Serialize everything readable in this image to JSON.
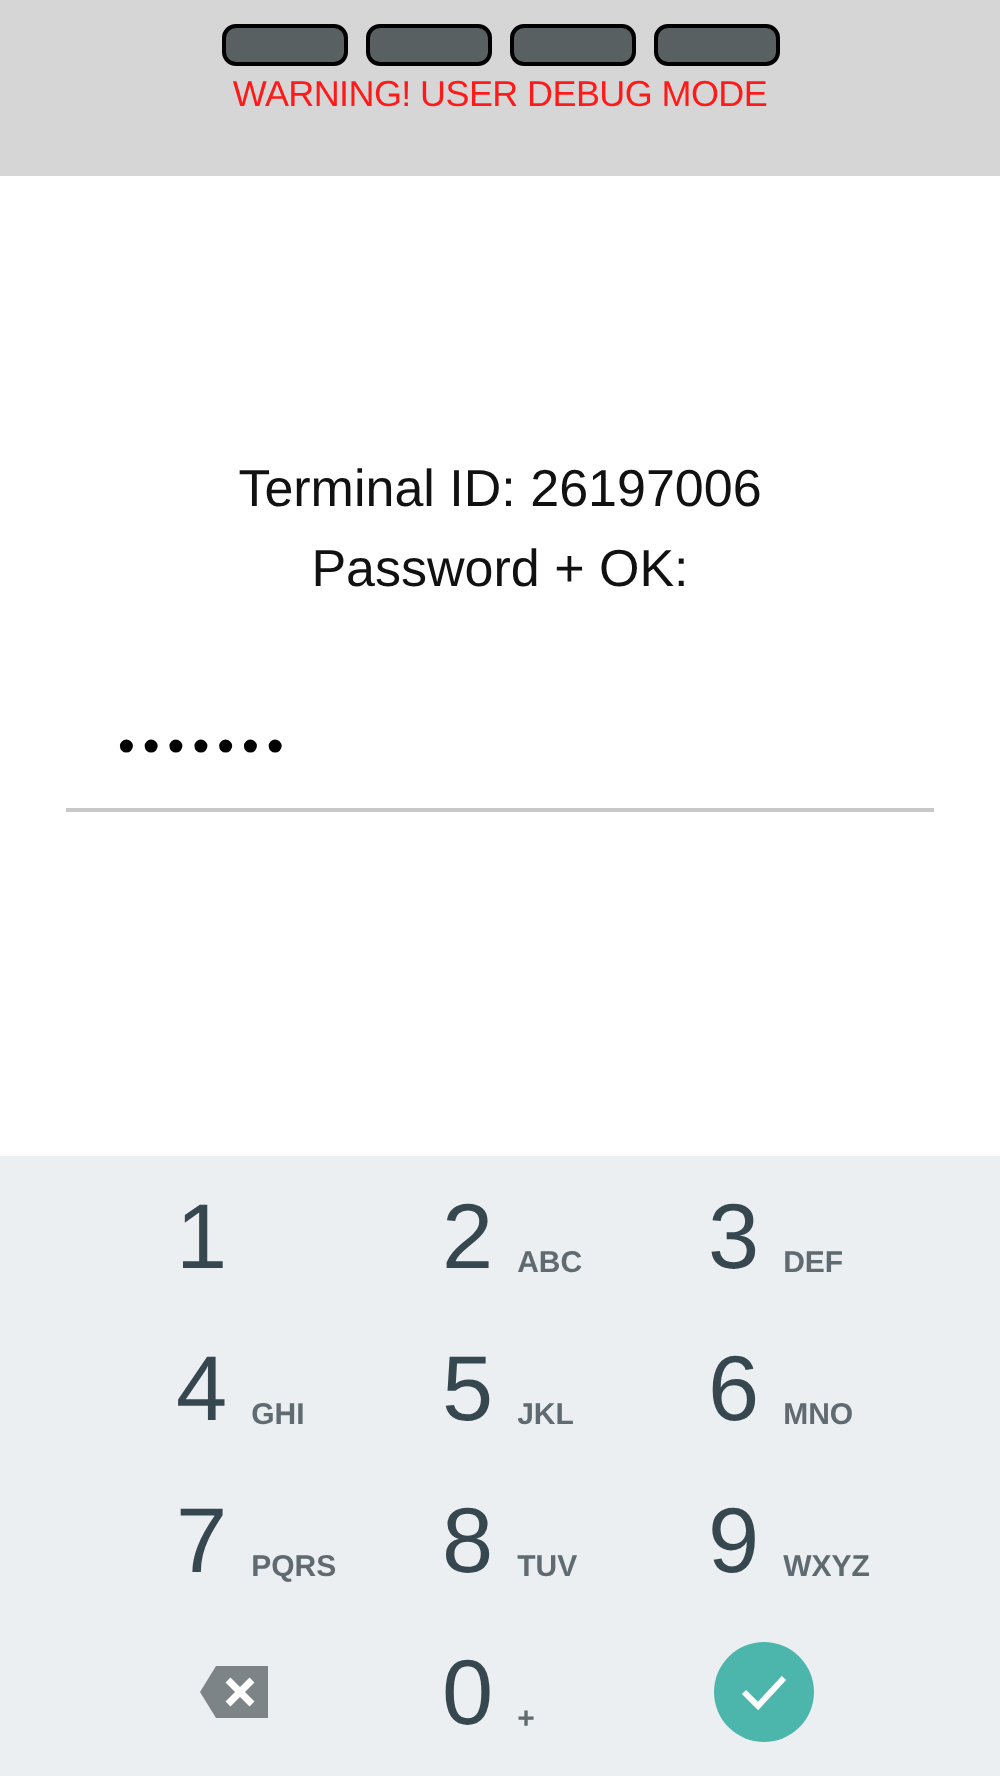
{
  "header": {
    "warning": "WARNING! USER DEBUG MODE"
  },
  "prompt": {
    "terminal": "Terminal ID: 26197006",
    "instruction": "Password + OK:"
  },
  "password_field": {
    "value": "•••••••"
  },
  "keypad": [
    {
      "kind": "digit",
      "digit": "1"
    },
    {
      "kind": "digit",
      "digit": "2",
      "letters": "ABC"
    },
    {
      "kind": "digit",
      "digit": "3",
      "letters": "DEF"
    },
    {
      "kind": "digit",
      "digit": "4",
      "letters": "GHI"
    },
    {
      "kind": "digit",
      "digit": "5",
      "letters": "JKL"
    },
    {
      "kind": "digit",
      "digit": "6",
      "letters": "MNO"
    },
    {
      "kind": "digit",
      "digit": "7",
      "letters": "PQRS"
    },
    {
      "kind": "digit",
      "digit": "8",
      "letters": "TUV"
    },
    {
      "kind": "digit",
      "digit": "9",
      "letters": "WXYZ"
    },
    {
      "kind": "backspace"
    },
    {
      "kind": "digit",
      "digit": "0",
      "letters": "+"
    },
    {
      "kind": "confirm"
    }
  ]
}
